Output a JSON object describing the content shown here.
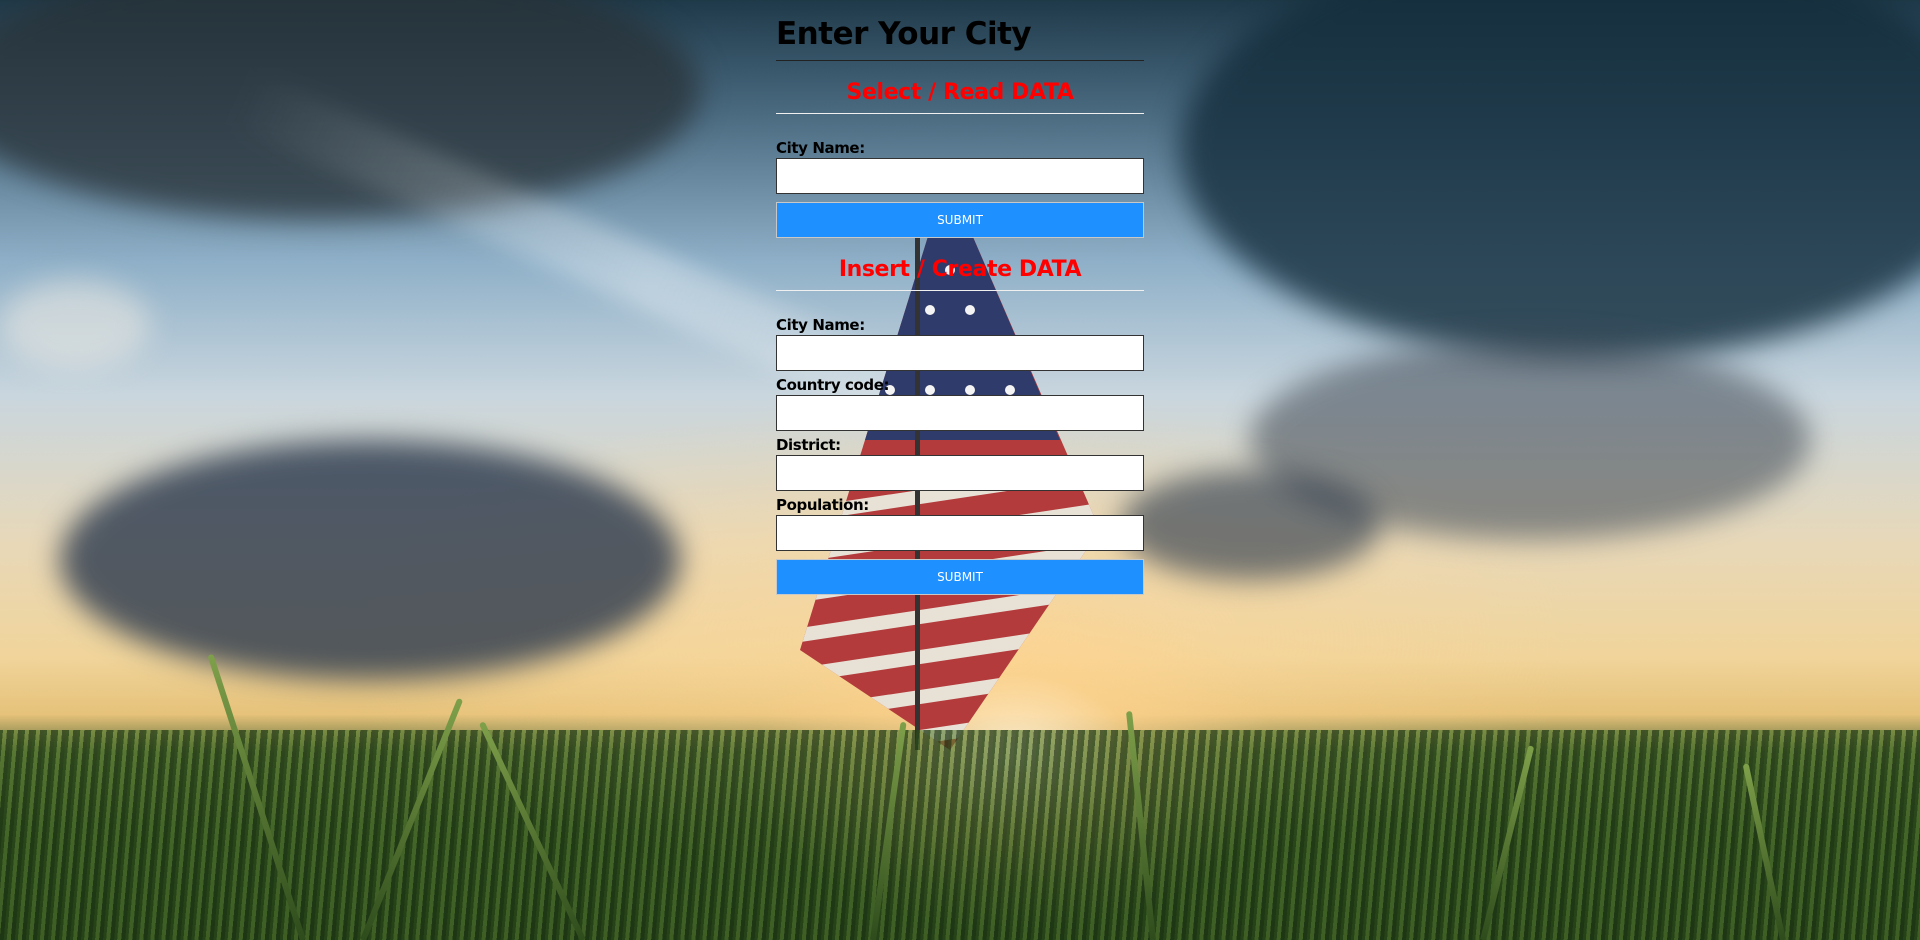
{
  "page": {
    "title": "Enter Your City"
  },
  "read_section": {
    "heading": "Select / Read DATA",
    "city_name_label": "City Name:",
    "city_name_value": "",
    "submit_label": "Submit"
  },
  "insert_section": {
    "heading": "Insert / Create DATA",
    "city_name_label": "City Name:",
    "city_name_value": "",
    "country_code_label": "Country code:",
    "country_code_value": "",
    "district_label": "District:",
    "district_value": "",
    "population_label": "Population:",
    "population_value": "",
    "submit_label": "Submit"
  },
  "colors": {
    "heading_accent": "#ff0000",
    "button_bg": "#1e90ff",
    "button_text": "#ffffff"
  }
}
